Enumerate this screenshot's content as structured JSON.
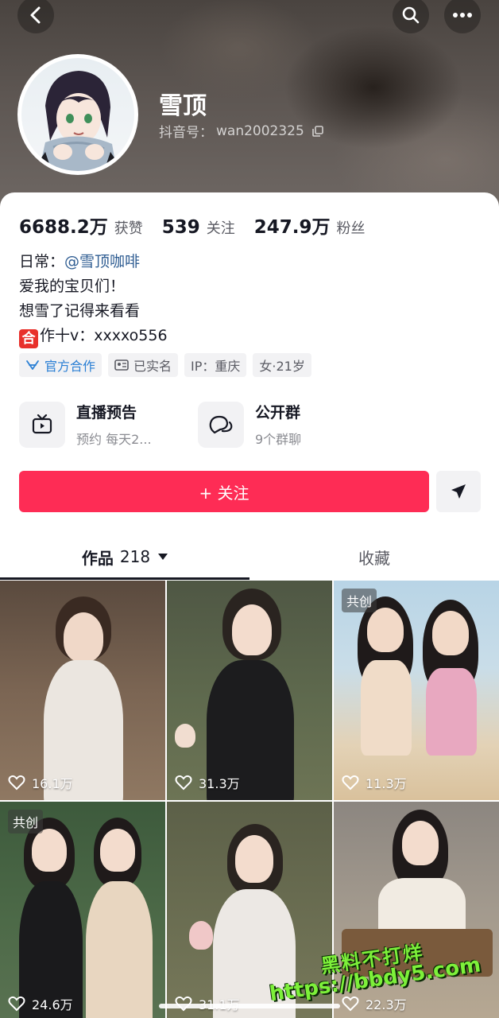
{
  "header": {
    "name": "雪顶",
    "id_label": "抖音号：",
    "id_value": "wan2002325"
  },
  "stats": [
    {
      "value": "6688.2万",
      "label": "获赞"
    },
    {
      "value": "539",
      "label": "关注"
    },
    {
      "value": "247.9万",
      "label": "粉丝"
    }
  ],
  "bio": {
    "line1_prefix": "日常：",
    "line1_mention": "@雪顶咖啡",
    "line2": "爱我的宝贝们！",
    "line3": "想雪了记得来看看",
    "line4_badge": "合",
    "line4_text": "作十v：xxxxo556"
  },
  "tags": [
    {
      "label": "官方合作",
      "icon": "official-icon"
    },
    {
      "label": "已实名",
      "icon": "id-card-icon"
    },
    {
      "label": "IP：重庆",
      "icon": ""
    },
    {
      "label": "女·21岁",
      "icon": ""
    }
  ],
  "features": [
    {
      "title": "直播预告",
      "subtitle": "预约 每天2...",
      "icon": "tv-icon"
    },
    {
      "title": "公开群",
      "subtitle": "9个群聊",
      "icon": "chat-bubbles-icon"
    }
  ],
  "follow_label": "+ 关注",
  "tabs": {
    "works_label": "作品",
    "works_count": "218",
    "favorites_label": "收藏"
  },
  "videos": [
    {
      "likes": "16.1万",
      "badge": ""
    },
    {
      "likes": "31.3万",
      "badge": ""
    },
    {
      "likes": "11.3万",
      "badge": "共创"
    },
    {
      "likes": "24.6万",
      "badge": "共创"
    },
    {
      "likes": "31.1万",
      "badge": ""
    },
    {
      "likes": "22.3万",
      "badge": ""
    }
  ],
  "watermark": {
    "text": "黑料不打烊",
    "url": "https://bbdy5.com"
  },
  "colors": {
    "accent": "#fe2c55",
    "mention": "#2f5d92",
    "official": "#2a7fd4"
  }
}
